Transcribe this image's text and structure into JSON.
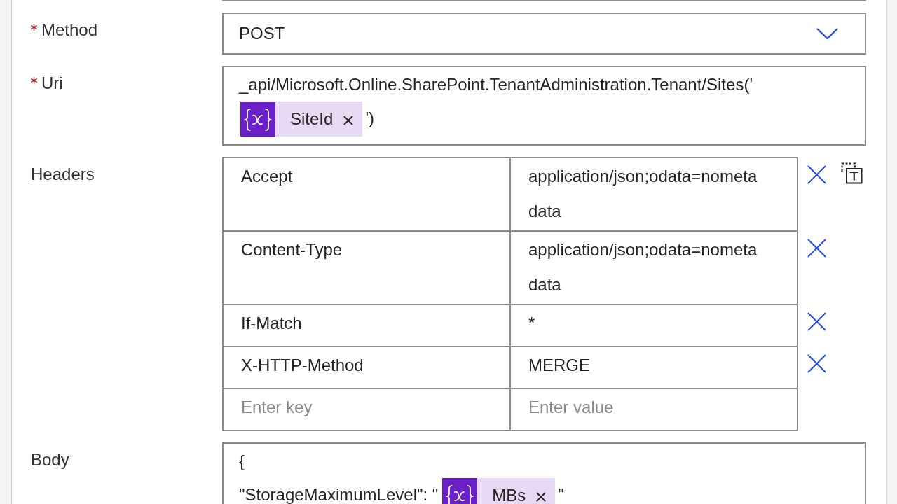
{
  "fields": [
    {
      "kind": "dropdown",
      "label": "Method",
      "required": true,
      "value": "POST"
    },
    {
      "kind": "expression",
      "label": "Uri",
      "required": true,
      "lines": [
        [
          {
            "kind": "text",
            "text": "_api/Microsoft.Online.SharePoint.TenantAdministration.Tenant/Sites('"
          }
        ],
        [
          {
            "kind": "token",
            "label": "SiteId"
          },
          {
            "kind": "text",
            "text": "')"
          }
        ]
      ]
    },
    {
      "kind": "key_value",
      "label": "Headers",
      "required": false,
      "rows": [
        {
          "key": "Accept",
          "value": "application/json;odata=nometadata"
        },
        {
          "key": "Content-Type",
          "value": "application/json;odata=nometadata"
        },
        {
          "key": "If-Match",
          "value": "*"
        },
        {
          "key": "X-HTTP-Method",
          "value": "MERGE"
        }
      ],
      "new_row": {
        "key_placeholder": "Enter key",
        "value_placeholder": "Enter value"
      }
    },
    {
      "kind": "expression",
      "label": "Body",
      "required": false,
      "lines": [
        [
          {
            "kind": "text",
            "text": "{"
          }
        ],
        [
          {
            "kind": "text",
            "text": "\"StorageMaximumLevel\": \""
          },
          {
            "kind": "token",
            "label": "MBs"
          },
          {
            "kind": "text",
            "text": "\""
          }
        ]
      ]
    }
  ]
}
